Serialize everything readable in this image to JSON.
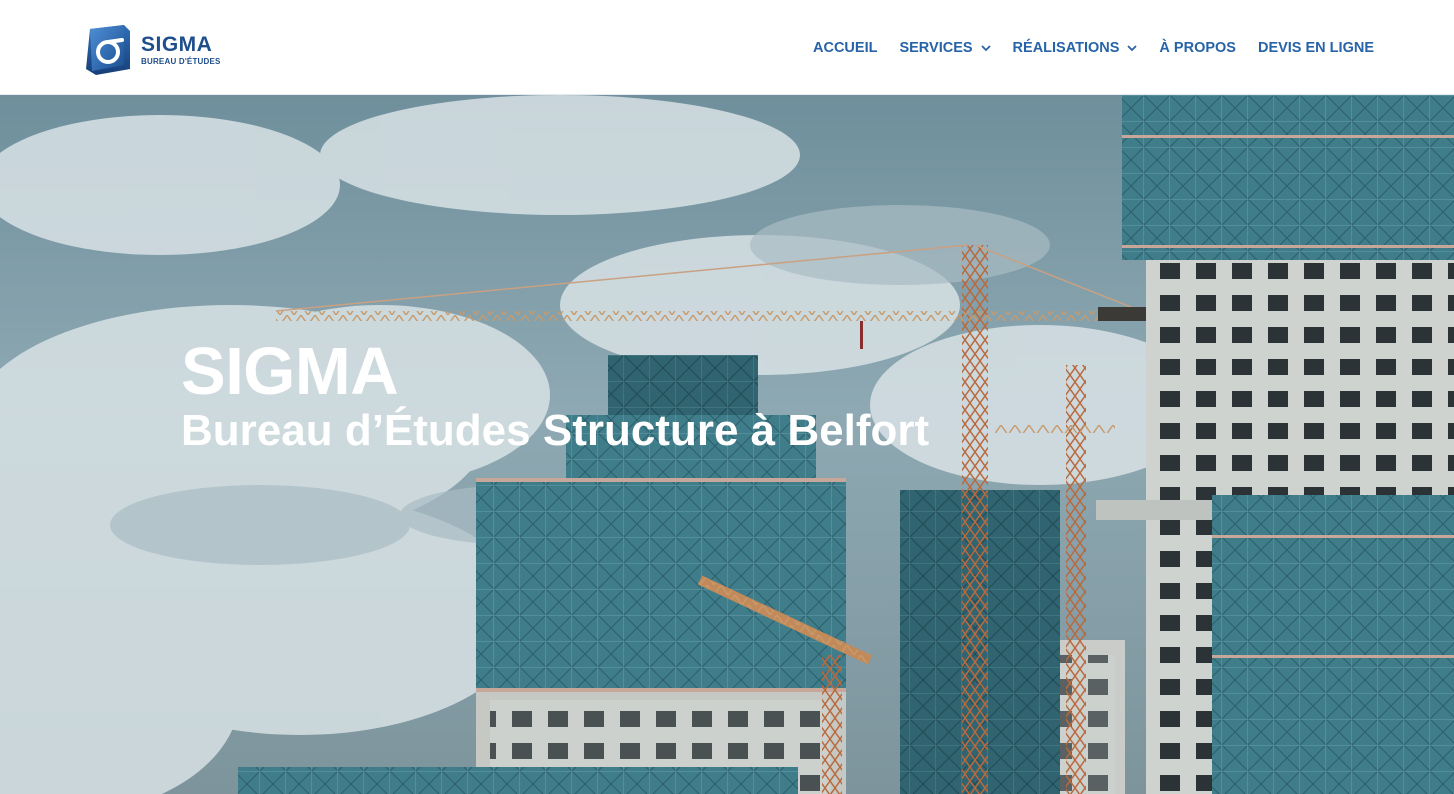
{
  "brand": {
    "name": "SIGMA",
    "tagline": "BUREAU D'ÉTUDES",
    "color": "#1f4e8c"
  },
  "nav": {
    "items": [
      {
        "label": "ACCUEIL",
        "has_dropdown": false
      },
      {
        "label": "SERVICES",
        "has_dropdown": true
      },
      {
        "label": "RÉALISATIONS",
        "has_dropdown": true
      },
      {
        "label": "À PROPOS",
        "has_dropdown": false
      },
      {
        "label": "DEVIS EN LIGNE",
        "has_dropdown": false
      }
    ],
    "color": "#2663a8",
    "dropdown_icon": "chevron-down-icon"
  },
  "hero": {
    "title": "SIGMA",
    "subtitle": "Bureau d’Études Structure à Belfort",
    "text_color": "#ffffff",
    "background": "construction site with tower cranes and teal-netted high-rise buildings under cloudy sky"
  }
}
